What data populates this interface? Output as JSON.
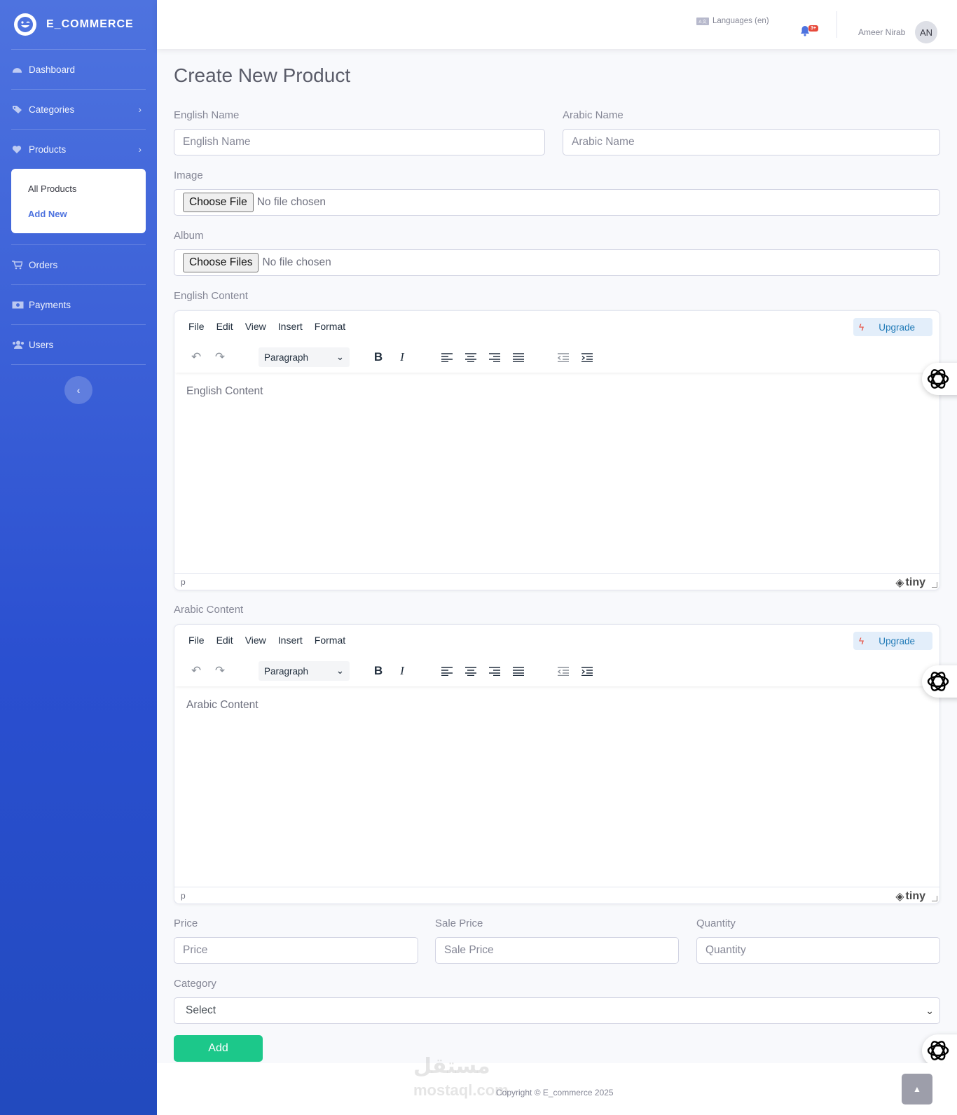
{
  "brand": {
    "name": "E_COMMERCE"
  },
  "sidebar": {
    "items": [
      {
        "label": "Dashboard",
        "icon": "dashboard-icon"
      },
      {
        "label": "Categories",
        "icon": "tags-icon"
      },
      {
        "label": "Products",
        "icon": "heart-icon"
      },
      {
        "label": "Orders",
        "icon": "cart-icon"
      },
      {
        "label": "Payments",
        "icon": "money-icon"
      },
      {
        "label": "Users",
        "icon": "users-icon"
      }
    ],
    "products_submenu": [
      {
        "label": "All Products"
      },
      {
        "label": "Add New"
      }
    ]
  },
  "topbar": {
    "language": "Languages (en)",
    "notification_badge": "3+",
    "user_name": "Ameer Nirab",
    "user_initials": "AN"
  },
  "page": {
    "title": "Create New Product"
  },
  "form": {
    "english_name": {
      "label": "English Name",
      "placeholder": "English Name"
    },
    "arabic_name": {
      "label": "Arabic Name",
      "placeholder": "Arabic Name"
    },
    "image": {
      "label": "Image",
      "button": "Choose File",
      "status": "No file chosen"
    },
    "album": {
      "label": "Album",
      "button": "Choose Files",
      "status": "No file chosen"
    },
    "english_content": {
      "label": "English Content",
      "placeholder": "English Content"
    },
    "arabic_content": {
      "label": "Arabic Content",
      "placeholder": "Arabic Content"
    },
    "price": {
      "label": "Price",
      "placeholder": "Price"
    },
    "sale_price": {
      "label": "Sale Price",
      "placeholder": "Sale Price"
    },
    "quantity": {
      "label": "Quantity",
      "placeholder": "Quantity"
    },
    "category": {
      "label": "Category",
      "selected": "Select"
    },
    "submit": "Add"
  },
  "editor": {
    "menu": [
      "File",
      "Edit",
      "View",
      "Insert",
      "Format"
    ],
    "upgrade": "Upgrade",
    "block_format": "Paragraph",
    "status_path": "p",
    "brand": "tiny"
  },
  "footer": {
    "copyright": "Copyright © E_commerce 2025",
    "watermark_ar": "مستقل",
    "watermark_en": "mostaql.com"
  },
  "colors": {
    "primary": "#4e73df",
    "success": "#1cc88a",
    "danger": "#e74a3b"
  }
}
